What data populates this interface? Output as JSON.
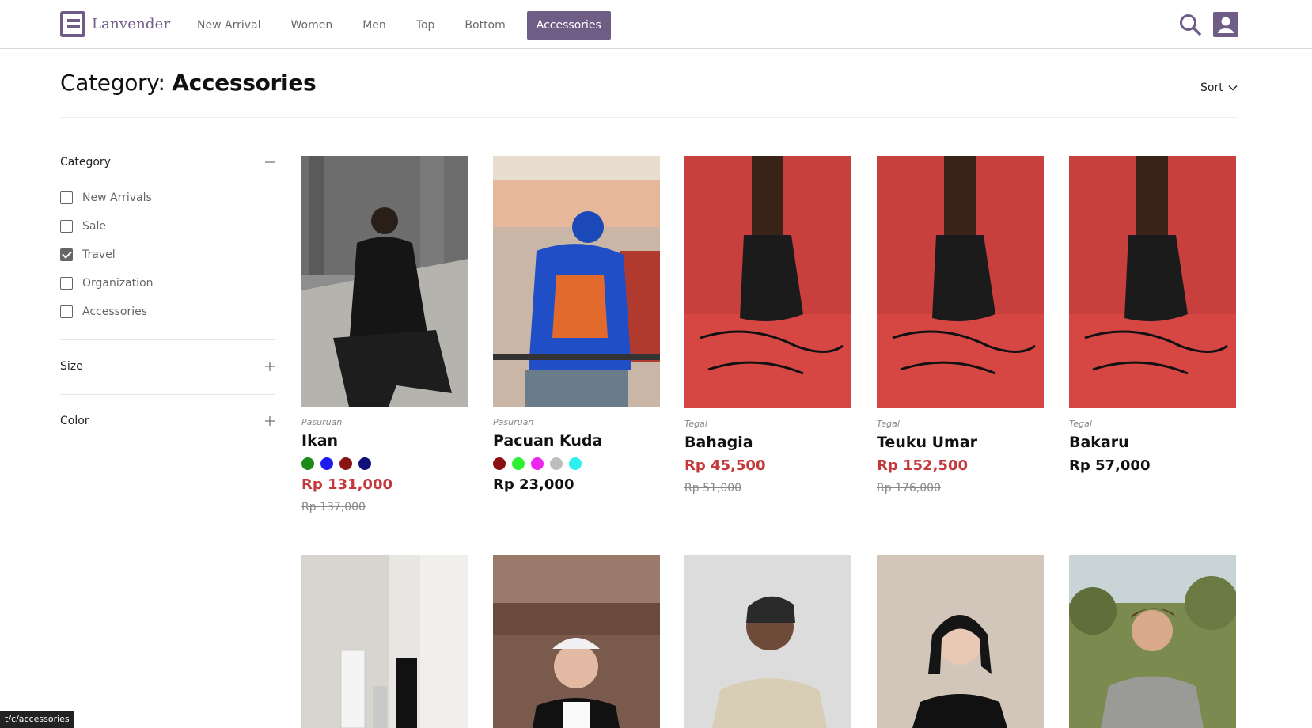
{
  "brand": {
    "name": "Lanvender"
  },
  "nav": [
    {
      "label": "New Arrival"
    },
    {
      "label": "Women"
    },
    {
      "label": "Men"
    },
    {
      "label": "Top"
    },
    {
      "label": "Bottom"
    },
    {
      "label": "Accessories",
      "active": true
    }
  ],
  "header_icons": [
    "search-icon",
    "user-icon"
  ],
  "page": {
    "title_prefix": "Category:",
    "title_value": "Accessories",
    "sort_label": "Sort"
  },
  "filters": {
    "category": {
      "label": "Category",
      "expanded": true,
      "options": [
        {
          "label": "New Arrivals",
          "checked": false
        },
        {
          "label": "Sale",
          "checked": false
        },
        {
          "label": "Travel",
          "checked": true
        },
        {
          "label": "Organization",
          "checked": false
        },
        {
          "label": "Accessories",
          "checked": false
        }
      ]
    },
    "size": {
      "label": "Size",
      "expanded": false
    },
    "color": {
      "label": "Color",
      "expanded": false
    }
  },
  "products": [
    {
      "location": "Pasuruan",
      "name": "Ikan",
      "swatches": [
        "#1a8a1a",
        "#1c1cf0",
        "#8a1313",
        "#0f0f7a"
      ],
      "price": "Rp 131,000",
      "old_price": "Rp 137,000"
    },
    {
      "location": "Pasuruan",
      "name": "Pacuan Kuda",
      "swatches": [
        "#8a1010",
        "#2ef02e",
        "#ee25ee",
        "#bdbdbd",
        "#2ef0ee"
      ],
      "price": "Rp 23,000",
      "old_price": ""
    },
    {
      "location": "Tegal",
      "name": "Bahagia",
      "swatches": [],
      "price": "Rp 45,500",
      "old_price": "Rp 51,000"
    },
    {
      "location": "Tegal",
      "name": "Teuku Umar",
      "swatches": [],
      "price": "Rp 152,500",
      "old_price": "Rp 176,000"
    },
    {
      "location": "Tegal",
      "name": "Bakaru",
      "swatches": [],
      "price": "Rp 57,000",
      "old_price": ""
    }
  ],
  "colors": {
    "accent": "#6f5d86",
    "sale_price": "#c4373b"
  },
  "status_url": "t/c/accessories"
}
